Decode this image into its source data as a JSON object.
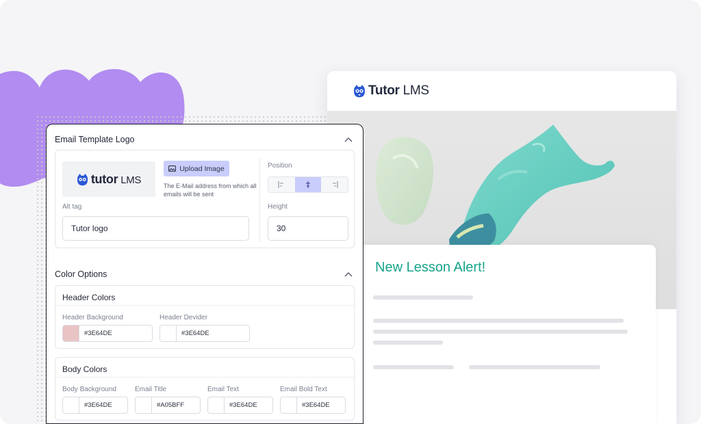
{
  "colors": {
    "accent": "#17a48b",
    "primary_soft": "#c9cdfb",
    "blob": "#b28cf0",
    "brand_dark": "#232a3d",
    "brand_blue": "#2a57d6",
    "swatch_pink": "#e9c4c4"
  },
  "preview": {
    "brand": {
      "name": "Tutor",
      "suffix": " LMS",
      "icon": "tutor-owl-icon"
    },
    "email_title": "New Lesson Alert!",
    "hero_image": "paint-brush-splash"
  },
  "panel": {
    "logo_section": {
      "title": "Email Template Logo",
      "logo_preview": {
        "name": "tutor",
        "suffix": " LMS",
        "icon": "tutor-owl-icon"
      },
      "upload_button": "Upload Image",
      "upload_icon": "image-icon",
      "help_text": "The E-Mail address from which all emails will be sent",
      "alt_label": "Alt tag",
      "alt_value": "Tutor logo",
      "position_label": "Position",
      "position_options": [
        "align-left-icon",
        "align-center-icon",
        "align-right-icon"
      ],
      "position_selected": "center",
      "height_label": "Height",
      "height_value": "30"
    },
    "color_section": {
      "title": "Color Options",
      "header_colors": {
        "title": "Header Colors",
        "fields": [
          {
            "label": "Header Background",
            "value": "#3E64DE",
            "swatch": "#e9c4c4"
          },
          {
            "label": "Header Devider",
            "value": "#3E64DE",
            "swatch": "#ffffff"
          }
        ]
      },
      "body_colors": {
        "title": "Body Colors",
        "fields": [
          {
            "label": "Body Background",
            "value": "#3E64DE",
            "swatch": "#ffffff"
          },
          {
            "label": "Email Title",
            "value": "#A05BFF",
            "swatch": "#ffffff"
          },
          {
            "label": "Email Text",
            "value": "#3E64DE",
            "swatch": "#ffffff"
          },
          {
            "label": "Email Bold Text",
            "value": "#3E64DE",
            "swatch": "#ffffff"
          }
        ]
      }
    }
  }
}
